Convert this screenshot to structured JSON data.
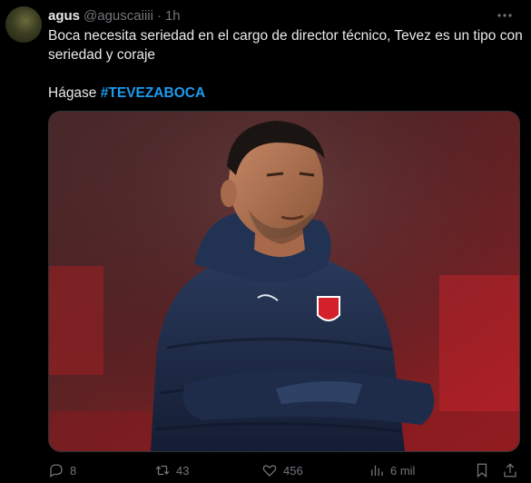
{
  "author": {
    "name": "agus",
    "handle": "@aguscaiiii",
    "separator": "·",
    "time": "1h"
  },
  "more_icon": "more-icon",
  "tweet": {
    "line1": "Boca necesita seriedad en el cargo de director técnico, Tevez es un tipo con seriedad y coraje",
    "line2_prefix": "Hágase ",
    "hashtag": "#TEVEZABOCA"
  },
  "media": {
    "icon": "photo-of-coach-in-padded-jacket"
  },
  "actions": {
    "reply_count": "8",
    "retweet_count": "43",
    "like_count": "456",
    "views_count": "6 mil"
  },
  "colors": {
    "background": "#000000",
    "text": "#e7e9ea",
    "muted": "#71767b",
    "link": "#1d9bf0"
  }
}
